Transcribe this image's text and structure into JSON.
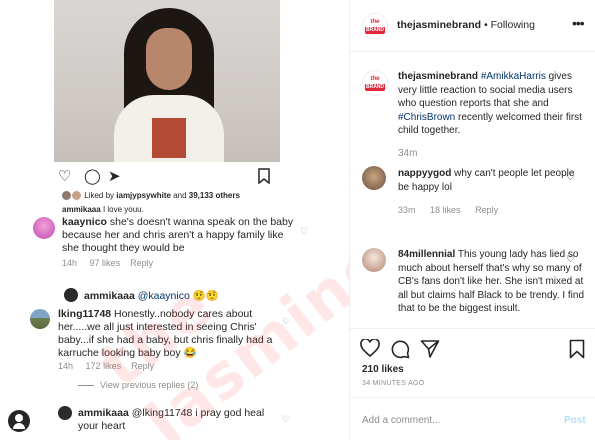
{
  "left_panel": {
    "liked_by_prefix": "Liked by",
    "liked_by_user": "iamjypsywhite",
    "liked_by_and": "and",
    "liked_by_others": "39,133 others",
    "caption_user": "ammikaaa",
    "caption_text": "I love youu.",
    "comments": [
      {
        "user": "kaaynico",
        "text": "she's doesn't wanna speak on the baby because her and chris aren't a happy family like she thought they would be",
        "time": "14h",
        "likes": "97 likes",
        "reply": "Reply"
      },
      {
        "user": "ammikaaa",
        "text": "@kaaynico 🤨🤨"
      },
      {
        "user": "lking11748",
        "text": "Honestly..nobody cares about her.....we all just interested in seeing Chris' baby...if she had a baby, but chris finally had a karruche looking baby boy 😂",
        "time": "14h",
        "likes": "172 likes",
        "reply": "Reply"
      },
      {
        "user": "ammikaaa",
        "text": "@lking11748 i pray god heal your heart"
      }
    ],
    "view_previous": "View previous replies (2)",
    "watermark": "theJasmine BRAND"
  },
  "right_panel": {
    "logo_top": "the",
    "logo_bottom": "BRAND",
    "account": "thejasminebrand",
    "separator": "•",
    "follow_status": "Following",
    "caption": {
      "user": "thejasminebrand",
      "hashtag1": "#AmikkaHarris",
      "text1": "gives very little reaction to social media users who question reports that she and",
      "hashtag2": "#ChrisBrown",
      "text2": "recently welcomed their first child together.",
      "time": "34m"
    },
    "comments": [
      {
        "user": "nappyygod",
        "text": "why can't people let people be happy lol",
        "time": "33m",
        "likes": "18 likes",
        "reply": "Reply"
      },
      {
        "user": "84millennial",
        "text": "This young lady has lied so much about herself that's why so many of CB's fans don't like her. She isn't mixed at all but claims half Black to be trendy. I find that to be the biggest insult."
      }
    ],
    "likes_count": "210 likes",
    "post_time": "34 MINUTES AGO",
    "comment_placeholder": "Add a comment...",
    "post_button": "Post"
  },
  "colors": {
    "hashtag": "#003569",
    "muted": "#8e8e8e",
    "post_disabled": "#b2dffc",
    "brand_red": "#e0283b"
  }
}
